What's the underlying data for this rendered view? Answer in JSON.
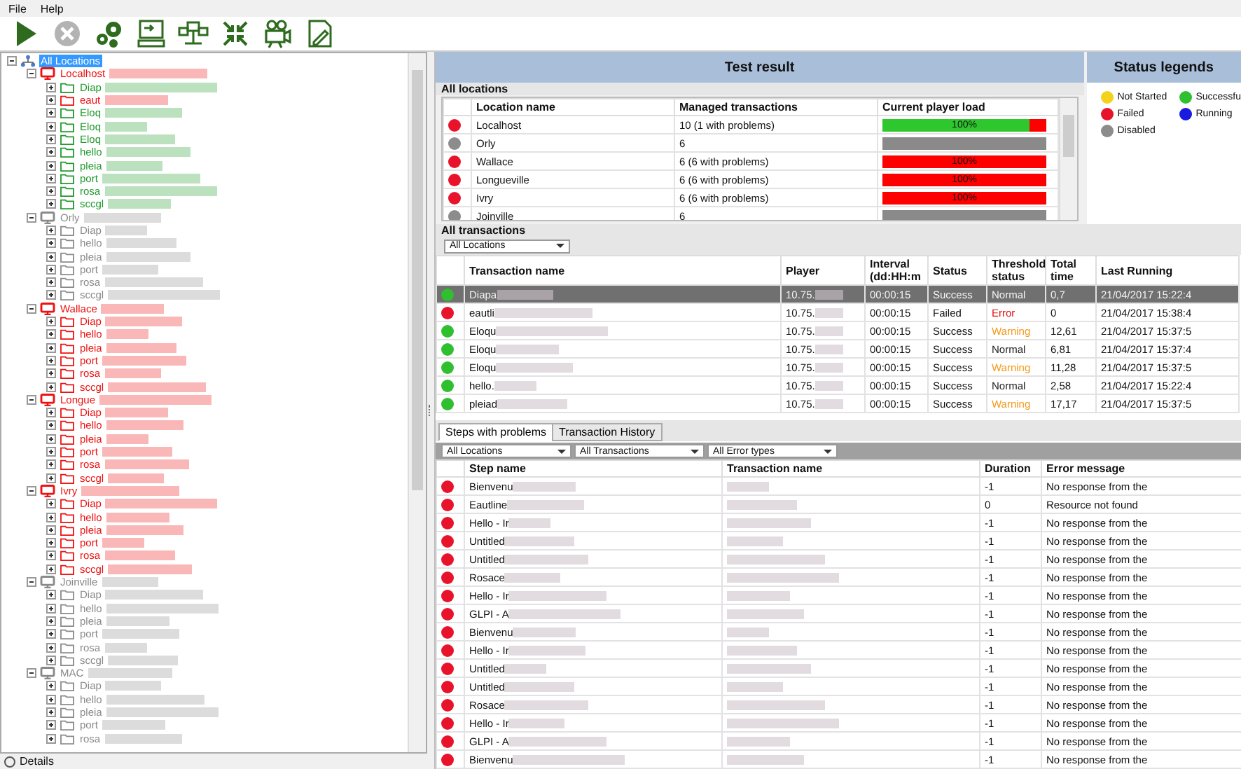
{
  "menu": [
    "File",
    "Help"
  ],
  "toolbar": [
    {
      "kind": "run",
      "disabled": false
    },
    {
      "kind": "stop",
      "disabled": true
    },
    {
      "kind": "settings",
      "disabled": false
    },
    {
      "kind": "console",
      "disabled": false
    },
    {
      "kind": "network",
      "disabled": false
    },
    {
      "kind": "collapse",
      "disabled": false
    },
    {
      "kind": "camera",
      "disabled": false
    },
    {
      "kind": "edit",
      "disabled": false
    }
  ],
  "tree": [
    {
      "label": "All Locations",
      "kind": "root",
      "selected": true,
      "expanded": true,
      "children": [
        {
          "label": "Localhost",
          "kind": "location",
          "color": "#ee1111",
          "selected": false,
          "expanded": true,
          "children": [
            {
              "label": "Diap",
              "kind": "folder",
              "color": "#1f9a2c",
              "selected": false,
              "expanded": false
            },
            {
              "label": "eaut",
              "kind": "folder",
              "color": "#ee1111",
              "selected": false,
              "expanded": false
            },
            {
              "label": "Eloq",
              "kind": "folder",
              "color": "#1f9a2c",
              "selected": false,
              "expanded": false
            },
            {
              "label": "Eloq",
              "kind": "folder",
              "color": "#1f9a2c",
              "selected": false,
              "expanded": false
            },
            {
              "label": "Eloq",
              "kind": "folder",
              "color": "#1f9a2c",
              "selected": false,
              "expanded": false
            },
            {
              "label": "hello",
              "kind": "folder",
              "color": "#1f9a2c",
              "selected": false,
              "expanded": false
            },
            {
              "label": "pleia",
              "kind": "folder",
              "color": "#1f9a2c",
              "selected": false,
              "expanded": false
            },
            {
              "label": "port",
              "kind": "folder",
              "color": "#1f9a2c",
              "selected": false,
              "expanded": false
            },
            {
              "label": "rosa",
              "kind": "folder",
              "color": "#1f9a2c",
              "selected": false,
              "expanded": false
            },
            {
              "label": "sccgl",
              "kind": "folder",
              "color": "#1f9a2c",
              "selected": false,
              "expanded": false
            }
          ]
        },
        {
          "label": "Orly",
          "kind": "location",
          "color": "#8a8a8a",
          "selected": false,
          "expanded": true,
          "children": [
            {
              "label": "Diap",
              "kind": "folder",
              "color": "#8a8a8a",
              "selected": false,
              "expanded": false
            },
            {
              "label": "hello",
              "kind": "folder",
              "color": "#8a8a8a",
              "selected": false,
              "expanded": false
            },
            {
              "label": "pleia",
              "kind": "folder",
              "color": "#8a8a8a",
              "selected": false,
              "expanded": false
            },
            {
              "label": "port",
              "kind": "folder",
              "color": "#8a8a8a",
              "selected": false,
              "expanded": false
            },
            {
              "label": "rosa",
              "kind": "folder",
              "color": "#8a8a8a",
              "selected": false,
              "expanded": false
            },
            {
              "label": "sccgl",
              "kind": "folder",
              "color": "#8a8a8a",
              "selected": false,
              "expanded": false
            }
          ]
        },
        {
          "label": "Wallace",
          "kind": "location",
          "color": "#ee1111",
          "selected": false,
          "expanded": true,
          "children": [
            {
              "label": "Diap",
              "kind": "folder",
              "color": "#ee1111",
              "selected": false,
              "expanded": false
            },
            {
              "label": "hello",
              "kind": "folder",
              "color": "#ee1111",
              "selected": false,
              "expanded": false
            },
            {
              "label": "pleia",
              "kind": "folder",
              "color": "#ee1111",
              "selected": false,
              "expanded": false
            },
            {
              "label": "port",
              "kind": "folder",
              "color": "#ee1111",
              "selected": false,
              "expanded": false
            },
            {
              "label": "rosa",
              "kind": "folder",
              "color": "#ee1111",
              "selected": false,
              "expanded": false
            },
            {
              "label": "sccgl",
              "kind": "folder",
              "color": "#ee1111",
              "selected": false,
              "expanded": false
            }
          ]
        },
        {
          "label": "Longue",
          "kind": "location",
          "color": "#ee1111",
          "selected": false,
          "expanded": true,
          "children": [
            {
              "label": "Diap",
              "kind": "folder",
              "color": "#ee1111",
              "selected": false,
              "expanded": false
            },
            {
              "label": "hello",
              "kind": "folder",
              "color": "#ee1111",
              "selected": false,
              "expanded": false
            },
            {
              "label": "pleia",
              "kind": "folder",
              "color": "#ee1111",
              "selected": false,
              "expanded": false
            },
            {
              "label": "port",
              "kind": "folder",
              "color": "#ee1111",
              "selected": false,
              "expanded": false
            },
            {
              "label": "rosa",
              "kind": "folder",
              "color": "#ee1111",
              "selected": false,
              "expanded": false
            },
            {
              "label": "sccgl",
              "kind": "folder",
              "color": "#ee1111",
              "selected": false,
              "expanded": false
            }
          ]
        },
        {
          "label": "Ivry",
          "kind": "location",
          "color": "#ee1111",
          "selected": false,
          "expanded": true,
          "children": [
            {
              "label": "Diap",
              "kind": "folder",
              "color": "#ee1111",
              "selected": false,
              "expanded": false
            },
            {
              "label": "hello",
              "kind": "folder",
              "color": "#ee1111",
              "selected": false,
              "expanded": false
            },
            {
              "label": "pleia",
              "kind": "folder",
              "color": "#ee1111",
              "selected": false,
              "expanded": false
            },
            {
              "label": "port",
              "kind": "folder",
              "color": "#ee1111",
              "selected": false,
              "expanded": false
            },
            {
              "label": "rosa",
              "kind": "folder",
              "color": "#ee1111",
              "selected": false,
              "expanded": false
            },
            {
              "label": "sccgl",
              "kind": "folder",
              "color": "#ee1111",
              "selected": false,
              "expanded": false
            }
          ]
        },
        {
          "label": "Joinville",
          "kind": "location",
          "color": "#8a8a8a",
          "selected": false,
          "expanded": true,
          "children": [
            {
              "label": "Diap",
              "kind": "folder",
              "color": "#8a8a8a",
              "selected": false,
              "expanded": false
            },
            {
              "label": "hello",
              "kind": "folder",
              "color": "#8a8a8a",
              "selected": false,
              "expanded": false
            },
            {
              "label": "pleia",
              "kind": "folder",
              "color": "#8a8a8a",
              "selected": false,
              "expanded": false
            },
            {
              "label": "port",
              "kind": "folder",
              "color": "#8a8a8a",
              "selected": false,
              "expanded": false
            },
            {
              "label": "rosa",
              "kind": "folder",
              "color": "#8a8a8a",
              "selected": false,
              "expanded": false
            },
            {
              "label": "sccgl",
              "kind": "folder",
              "color": "#8a8a8a",
              "selected": false,
              "expanded": false
            }
          ]
        },
        {
          "label": "MAC",
          "kind": "location",
          "color": "#8a8a8a",
          "selected": false,
          "expanded": true,
          "children": [
            {
              "label": "Diap",
              "kind": "folder",
              "color": "#8a8a8a",
              "selected": false,
              "expanded": false
            },
            {
              "label": "hello",
              "kind": "folder",
              "color": "#8a8a8a",
              "selected": false,
              "expanded": false
            },
            {
              "label": "pleia",
              "kind": "folder",
              "color": "#8a8a8a",
              "selected": false,
              "expanded": false
            },
            {
              "label": "port",
              "kind": "folder",
              "color": "#8a8a8a",
              "selected": false,
              "expanded": false
            },
            {
              "label": "rosa",
              "kind": "folder",
              "color": "#8a8a8a",
              "selected": false,
              "expanded": false
            }
          ]
        }
      ]
    }
  ],
  "details": {
    "label": "Details"
  },
  "test_result": {
    "title": "Test result",
    "section": "All locations",
    "columns": [
      "Location name",
      "Managed transactions",
      "Current player load"
    ],
    "rows": [
      {
        "color": "#e8132b",
        "name": "Localhost",
        "managed": "10 (1 with problems)",
        "load": {
          "level": 0.9,
          "color": "#2ec82e",
          "label": "100%"
        }
      },
      {
        "color": "#8c8c8c",
        "name": "Orly",
        "managed": "6",
        "load": {
          "level": 1,
          "color": "#8a8a8a"
        }
      },
      {
        "color": "#e8132b",
        "name": "Wallace",
        "managed": "6 (6 with problems)",
        "load": {
          "level": 1,
          "color": "#ff0000",
          "label": "100%"
        }
      },
      {
        "color": "#e8132b",
        "name": "Longueville",
        "managed": "6 (6 with problems)",
        "load": {
          "level": 1,
          "color": "#ff0000",
          "label": "100%"
        }
      },
      {
        "color": "#e8132b",
        "name": "Ivry",
        "managed": "6 (6 with problems)",
        "load": {
          "level": 1,
          "color": "#ff0000",
          "label": "100%"
        }
      },
      {
        "color": "#8c8c8c",
        "name": "Joinville",
        "managed": "6",
        "load": {
          "level": 1,
          "color": "#8a8a8a"
        }
      }
    ]
  },
  "legends": {
    "title": "Status legends",
    "items": [
      {
        "label": "Not Started",
        "color": "#f2d21a"
      },
      {
        "label": "Successfu",
        "color": "#2fbf2f"
      },
      {
        "label": "Failed",
        "color": "#e8132b"
      },
      {
        "label": "Running",
        "color": "#1a1ae0"
      },
      {
        "label": "Disabled",
        "color": "#8c8c8c"
      }
    ]
  },
  "transactions": {
    "section": "All transactions",
    "filter": "All Locations",
    "columns": [
      "Transaction name",
      "Player",
      "Interval (dd:HH:m",
      "Status",
      "Threshold status",
      "Total time",
      "Last Running"
    ],
    "rows": [
      {
        "color": "#2fbf2f",
        "selected": true,
        "name": "Diapa",
        "player": "10.75.",
        "interval": "00:00:15",
        "result": "Success",
        "threshold": {
          "label": "Normal",
          "kind": "normal"
        },
        "total": "0,7",
        "last": "21/04/2017 15:22:4"
      },
      {
        "color": "#e8132b",
        "selected": false,
        "name": "eautli",
        "player": "10.75.",
        "interval": "00:00:15",
        "result": "Failed",
        "threshold": {
          "label": "Error",
          "kind": "error"
        },
        "total": "0",
        "last": "21/04/2017 15:38:4"
      },
      {
        "color": "#2fbf2f",
        "selected": false,
        "name": "Eloqu",
        "player": "10.75.",
        "interval": "00:00:15",
        "result": "Success",
        "threshold": {
          "label": "Warning",
          "kind": "warning"
        },
        "total": "12,61",
        "last": "21/04/2017 15:37:5"
      },
      {
        "color": "#2fbf2f",
        "selected": false,
        "name": "Eloqu",
        "player": "10.75.",
        "interval": "00:00:15",
        "result": "Success",
        "threshold": {
          "label": "Normal",
          "kind": "normal"
        },
        "total": "6,81",
        "last": "21/04/2017 15:37:4"
      },
      {
        "color": "#2fbf2f",
        "selected": false,
        "name": "Eloqu",
        "player": "10.75.",
        "interval": "00:00:15",
        "result": "Success",
        "threshold": {
          "label": "Warning",
          "kind": "warning"
        },
        "total": "11,28",
        "last": "21/04/2017 15:37:5"
      },
      {
        "color": "#2fbf2f",
        "selected": false,
        "name": "hello.",
        "player": "10.75.",
        "interval": "00:00:15",
        "result": "Success",
        "threshold": {
          "label": "Normal",
          "kind": "normal"
        },
        "total": "2,58",
        "last": "21/04/2017 15:22:4"
      },
      {
        "color": "#2fbf2f",
        "selected": false,
        "name": "pleiad",
        "player": "10.75.",
        "interval": "00:00:15",
        "result": "Success",
        "threshold": {
          "label": "Warning",
          "kind": "warning"
        },
        "total": "17,17",
        "last": "21/04/2017 15:37:5"
      }
    ]
  },
  "tabs": [
    {
      "label": "Steps with problems",
      "selected": true
    },
    {
      "label": "Transaction History",
      "selected": false
    }
  ],
  "filters": [
    "All Locations",
    "All Transactions",
    "All Error types"
  ],
  "steps": {
    "columns": [
      "Step name",
      "Transaction name",
      "Duration",
      "Error message"
    ],
    "rows": [
      {
        "color": "#e8132b",
        "name": "Bienvenu",
        "duration": "-1",
        "error": "No response from the"
      },
      {
        "color": "#e8132b",
        "name": "Eautline",
        "duration": "0",
        "error": "Resource not found"
      },
      {
        "color": "#e8132b",
        "name": "Hello - Ir",
        "duration": "-1",
        "error": "No response from the"
      },
      {
        "color": "#e8132b",
        "name": "Untitled",
        "duration": "-1",
        "error": "No response from the"
      },
      {
        "color": "#e8132b",
        "name": "Untitled",
        "duration": "-1",
        "error": "No response from the"
      },
      {
        "color": "#e8132b",
        "name": "Rosace",
        "duration": "-1",
        "error": "No response from the"
      },
      {
        "color": "#e8132b",
        "name": "Hello - Ir",
        "duration": "-1",
        "error": "No response from the"
      },
      {
        "color": "#e8132b",
        "name": "GLPI - A",
        "duration": "-1",
        "error": "No response from the"
      },
      {
        "color": "#e8132b",
        "name": "Bienvenu",
        "duration": "-1",
        "error": "No response from the"
      },
      {
        "color": "#e8132b",
        "name": "Hello - Ir",
        "duration": "-1",
        "error": "No response from the"
      },
      {
        "color": "#e8132b",
        "name": "Untitled",
        "duration": "-1",
        "error": "No response from the"
      },
      {
        "color": "#e8132b",
        "name": "Untitled",
        "duration": "-1",
        "error": "No response from the"
      },
      {
        "color": "#e8132b",
        "name": "Rosace",
        "duration": "-1",
        "error": "No response from the"
      },
      {
        "color": "#e8132b",
        "name": "Hello - Ir",
        "duration": "-1",
        "error": "No response from the"
      },
      {
        "color": "#e8132b",
        "name": "GLPI - A",
        "duration": "-1",
        "error": "No response from the"
      },
      {
        "color": "#e8132b",
        "name": "Bienvenu",
        "duration": "-1",
        "error": "No response from the"
      }
    ]
  }
}
